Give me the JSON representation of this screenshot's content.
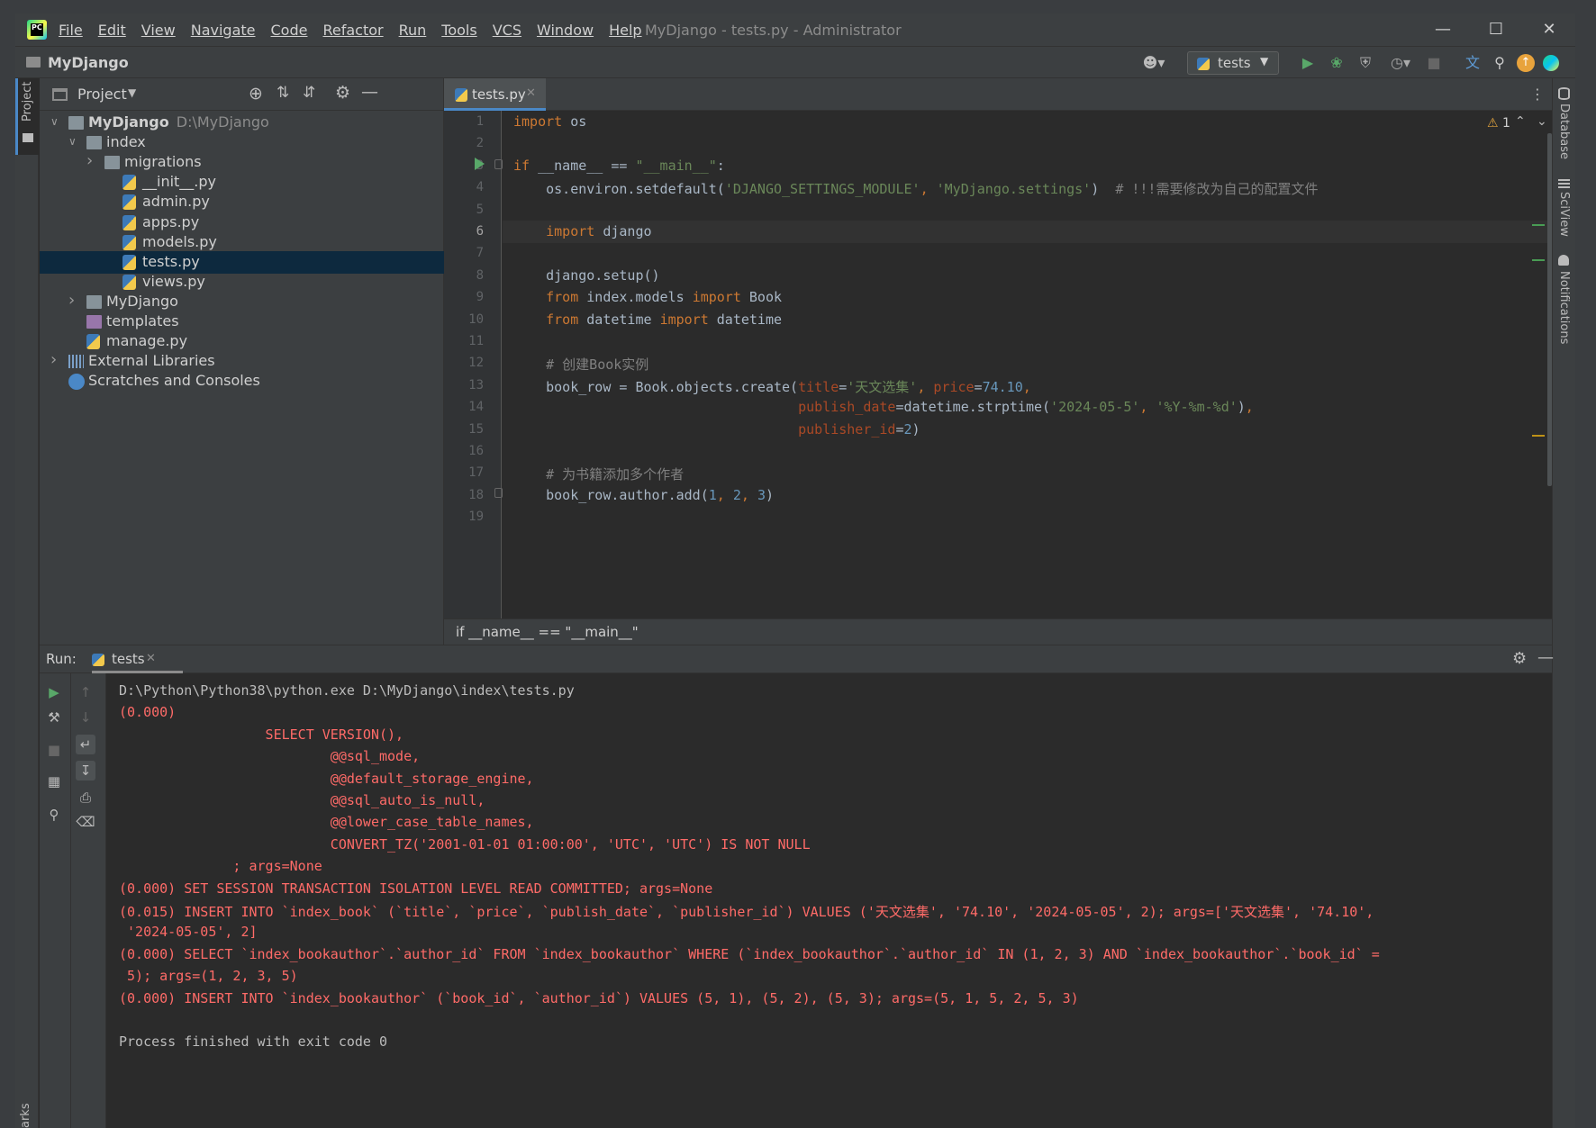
{
  "menu": [
    "File",
    "Edit",
    "View",
    "Navigate",
    "Code",
    "Refactor",
    "Run",
    "Tools",
    "VCS",
    "Window",
    "Help"
  ],
  "window_title": "MyDjango - tests.py - Administrator",
  "nav_project": "MyDjango",
  "run_config": "tests",
  "project_panel": {
    "title": "Project",
    "tree": [
      {
        "label": "MyDjango",
        "path": "D:\\MyDjango",
        "depth": 0,
        "expanded": true,
        "icon": "folder-icon",
        "bold": true
      },
      {
        "label": "index",
        "depth": 1,
        "expanded": true,
        "icon": "folder-icon"
      },
      {
        "label": "migrations",
        "depth": 2,
        "expanded": false,
        "icon": "folder-icon"
      },
      {
        "label": "__init__.py",
        "depth": 3,
        "icon": "python-file-icon"
      },
      {
        "label": "admin.py",
        "depth": 3,
        "icon": "python-file-icon"
      },
      {
        "label": "apps.py",
        "depth": 3,
        "icon": "python-file-icon"
      },
      {
        "label": "models.py",
        "depth": 3,
        "icon": "python-file-icon"
      },
      {
        "label": "tests.py",
        "depth": 3,
        "icon": "python-file-icon",
        "selected": true
      },
      {
        "label": "views.py",
        "depth": 3,
        "icon": "python-file-icon"
      },
      {
        "label": "MyDjango",
        "depth": 1,
        "expanded": false,
        "icon": "folder-icon"
      },
      {
        "label": "templates",
        "depth": 1,
        "icon": "templates-folder-icon"
      },
      {
        "label": "manage.py",
        "depth": 1,
        "icon": "python-file-icon"
      },
      {
        "label": "External Libraries",
        "depth": 0,
        "expanded": false,
        "icon": "library-icon"
      },
      {
        "label": "Scratches and Consoles",
        "depth": 0,
        "icon": "scratches-icon"
      }
    ]
  },
  "editor": {
    "tab": "tests.py",
    "warnings": "1",
    "current_line": 6,
    "lines": [
      "import os",
      "",
      "if __name__ == \"__main__\":",
      "    os.environ.setdefault('DJANGO_SETTINGS_MODULE', 'MyDjango.settings')  # !!!需要修改为自己的配置文件",
      "",
      "    import django",
      "",
      "    django.setup()",
      "    from index.models import Book",
      "    from datetime import datetime",
      "",
      "    # 创建Book实例",
      "    book_row = Book.objects.create(title='天文选集', price=74.10,",
      "                                   publish_date=datetime.strptime('2024-05-5', '%Y-%m-%d'),",
      "                                   publisher_id=2)",
      "",
      "    # 为书籍添加多个作者",
      "    book_row.author.add(1, 2, 3)",
      ""
    ]
  },
  "breadcrumb": "if __name__ == \"__main__\"",
  "right_stripe": [
    "Database",
    "SciView",
    "Notifications"
  ],
  "left_stripe": [
    "Project",
    "arks"
  ],
  "run_panel": {
    "label": "Run:",
    "tab": "tests",
    "output": [
      {
        "text": "D:\\Python\\Python38\\python.exe D:\\MyDjango\\index\\tests.py",
        "kind": "normal"
      },
      {
        "text": "(0.000)",
        "kind": "err"
      },
      {
        "text": "                  SELECT VERSION(),",
        "kind": "err"
      },
      {
        "text": "                          @@sql_mode,",
        "kind": "err"
      },
      {
        "text": "                          @@default_storage_engine,",
        "kind": "err"
      },
      {
        "text": "                          @@sql_auto_is_null,",
        "kind": "err"
      },
      {
        "text": "                          @@lower_case_table_names,",
        "kind": "err"
      },
      {
        "text": "                          CONVERT_TZ('2001-01-01 01:00:00', 'UTC', 'UTC') IS NOT NULL",
        "kind": "err"
      },
      {
        "text": "              ; args=None",
        "kind": "err"
      },
      {
        "text": "(0.000) SET SESSION TRANSACTION ISOLATION LEVEL READ COMMITTED; args=None",
        "kind": "err"
      },
      {
        "text": "(0.015) INSERT INTO `index_book` (`title`, `price`, `publish_date`, `publisher_id`) VALUES ('天文选集', '74.10', '2024-05-05', 2); args=['天文选集', '74.10',",
        "kind": "err"
      },
      {
        "text": " '2024-05-05', 2]",
        "kind": "err"
      },
      {
        "text": "(0.000) SELECT `index_bookauthor`.`author_id` FROM `index_bookauthor` WHERE (`index_bookauthor`.`author_id` IN (1, 2, 3) AND `index_bookauthor`.`book_id` =",
        "kind": "err"
      },
      {
        "text": " 5); args=(1, 2, 3, 5)",
        "kind": "err"
      },
      {
        "text": "(0.000) INSERT INTO `index_bookauthor` (`book_id`, `author_id`) VALUES (5, 1), (5, 2), (5, 3); args=(5, 1, 5, 2, 5, 3)",
        "kind": "err"
      },
      {
        "text": "",
        "kind": "normal"
      },
      {
        "text": "Process finished with exit code 0",
        "kind": "normal"
      }
    ]
  },
  "colors": {
    "keyword": "#cc7832",
    "string": "#6a8759",
    "comment": "#808080",
    "number": "#6897bb",
    "param": "#aa4926",
    "error_output": "#ff6b68",
    "selection": "#0d293e",
    "accent": "#4a88c7"
  }
}
